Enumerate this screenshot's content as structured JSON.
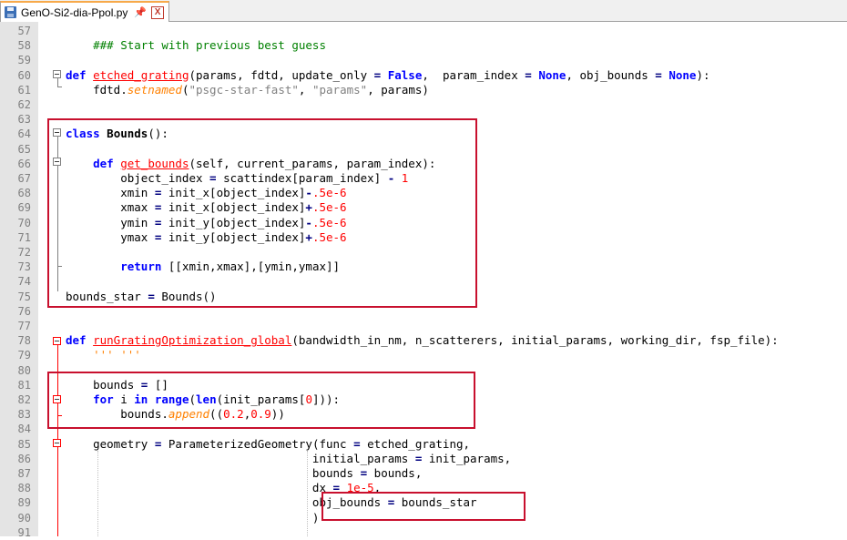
{
  "tab": {
    "filename": "GenO-Si2-dia-Ppol.py",
    "close_glyph": "X",
    "pin_glyph": "📌"
  },
  "editor": {
    "first_line": 57,
    "lines": [
      {
        "n": "57",
        "tokens": []
      },
      {
        "n": "58",
        "tokens": [
          {
            "t": "    ",
            "c": ""
          },
          {
            "t": "### Start with previous best guess",
            "c": "cm"
          }
        ]
      },
      {
        "n": "59",
        "tokens": []
      },
      {
        "n": "60",
        "tokens": [
          {
            "t": "def",
            "c": "kw"
          },
          {
            "t": " ",
            "c": ""
          },
          {
            "t": "etched_grating",
            "c": "fn"
          },
          {
            "t": "(params, fdtd, update_only ",
            "c": ""
          },
          {
            "t": "=",
            "c": "op"
          },
          {
            "t": " ",
            "c": ""
          },
          {
            "t": "False",
            "c": "kw"
          },
          {
            "t": ",  param_index ",
            "c": ""
          },
          {
            "t": "=",
            "c": "op"
          },
          {
            "t": " ",
            "c": ""
          },
          {
            "t": "None",
            "c": "kw"
          },
          {
            "t": ", obj_bounds ",
            "c": ""
          },
          {
            "t": "=",
            "c": "op"
          },
          {
            "t": " ",
            "c": ""
          },
          {
            "t": "None",
            "c": "kw"
          },
          {
            "t": "):",
            "c": ""
          }
        ]
      },
      {
        "n": "61",
        "tokens": [
          {
            "t": "    fdtd.",
            "c": ""
          },
          {
            "t": "setnamed",
            "c": "meth"
          },
          {
            "t": "(",
            "c": ""
          },
          {
            "t": "\"psgc-star-fast\"",
            "c": "str"
          },
          {
            "t": ", ",
            "c": ""
          },
          {
            "t": "\"params\"",
            "c": "str"
          },
          {
            "t": ", params)",
            "c": ""
          }
        ]
      },
      {
        "n": "62",
        "tokens": []
      },
      {
        "n": "63",
        "tokens": []
      },
      {
        "n": "64",
        "tokens": [
          {
            "t": "class",
            "c": "kw"
          },
          {
            "t": " ",
            "c": ""
          },
          {
            "t": "Bounds",
            "c": "cls"
          },
          {
            "t": "():",
            "c": ""
          }
        ]
      },
      {
        "n": "65",
        "tokens": []
      },
      {
        "n": "66",
        "tokens": [
          {
            "t": "    ",
            "c": ""
          },
          {
            "t": "def",
            "c": "kw"
          },
          {
            "t": " ",
            "c": ""
          },
          {
            "t": "get_bounds",
            "c": "fn"
          },
          {
            "t": "(self, current_params, param_index):",
            "c": ""
          }
        ]
      },
      {
        "n": "67",
        "tokens": [
          {
            "t": "        object_index ",
            "c": ""
          },
          {
            "t": "=",
            "c": "op"
          },
          {
            "t": " scattindex[param_index] ",
            "c": ""
          },
          {
            "t": "-",
            "c": "op"
          },
          {
            "t": " ",
            "c": ""
          },
          {
            "t": "1",
            "c": "num"
          }
        ]
      },
      {
        "n": "68",
        "tokens": [
          {
            "t": "        xmin ",
            "c": ""
          },
          {
            "t": "=",
            "c": "op"
          },
          {
            "t": " init_x[object_index]",
            "c": ""
          },
          {
            "t": "-",
            "c": "op"
          },
          {
            "t": ".5e-6",
            "c": "num"
          }
        ]
      },
      {
        "n": "69",
        "tokens": [
          {
            "t": "        xmax ",
            "c": ""
          },
          {
            "t": "=",
            "c": "op"
          },
          {
            "t": " init_x[object_index]",
            "c": ""
          },
          {
            "t": "+",
            "c": "op"
          },
          {
            "t": ".5e-6",
            "c": "num"
          }
        ]
      },
      {
        "n": "70",
        "tokens": [
          {
            "t": "        ymin ",
            "c": ""
          },
          {
            "t": "=",
            "c": "op"
          },
          {
            "t": " init_y[object_index]",
            "c": ""
          },
          {
            "t": "-",
            "c": "op"
          },
          {
            "t": ".5e-6",
            "c": "num"
          }
        ]
      },
      {
        "n": "71",
        "tokens": [
          {
            "t": "        ymax ",
            "c": ""
          },
          {
            "t": "=",
            "c": "op"
          },
          {
            "t": " init_y[object_index]",
            "c": ""
          },
          {
            "t": "+",
            "c": "op"
          },
          {
            "t": ".5e-6",
            "c": "num"
          }
        ]
      },
      {
        "n": "72",
        "tokens": []
      },
      {
        "n": "73",
        "tokens": [
          {
            "t": "        ",
            "c": ""
          },
          {
            "t": "return",
            "c": "kw"
          },
          {
            "t": " [[xmin,xmax],[ymin,ymax]]",
            "c": ""
          }
        ]
      },
      {
        "n": "74",
        "tokens": []
      },
      {
        "n": "75",
        "tokens": [
          {
            "t": "bounds_star ",
            "c": ""
          },
          {
            "t": "=",
            "c": "op"
          },
          {
            "t": " Bounds()",
            "c": ""
          }
        ]
      },
      {
        "n": "76",
        "tokens": []
      },
      {
        "n": "77",
        "tokens": []
      },
      {
        "n": "78",
        "tokens": [
          {
            "t": "def",
            "c": "kw"
          },
          {
            "t": " ",
            "c": ""
          },
          {
            "t": "runGratingOptimization_global",
            "c": "fn"
          },
          {
            "t": "(bandwidth_in_nm, n_scatterers, initial_params, working_dir, fsp_file):",
            "c": ""
          }
        ]
      },
      {
        "n": "79",
        "tokens": [
          {
            "t": "    ",
            "c": ""
          },
          {
            "t": "''' '''",
            "c": "meth"
          }
        ]
      },
      {
        "n": "80",
        "tokens": []
      },
      {
        "n": "81",
        "tokens": [
          {
            "t": "    bounds ",
            "c": ""
          },
          {
            "t": "=",
            "c": "op"
          },
          {
            "t": " []",
            "c": ""
          }
        ]
      },
      {
        "n": "82",
        "tokens": [
          {
            "t": "    ",
            "c": ""
          },
          {
            "t": "for",
            "c": "kw"
          },
          {
            "t": " i ",
            "c": ""
          },
          {
            "t": "in",
            "c": "kw"
          },
          {
            "t": " ",
            "c": ""
          },
          {
            "t": "range",
            "c": "kw"
          },
          {
            "t": "(",
            "c": ""
          },
          {
            "t": "len",
            "c": "kw"
          },
          {
            "t": "(init_params[",
            "c": ""
          },
          {
            "t": "0",
            "c": "num"
          },
          {
            "t": "])):",
            "c": ""
          }
        ]
      },
      {
        "n": "83",
        "tokens": [
          {
            "t": "        bounds.",
            "c": ""
          },
          {
            "t": "append",
            "c": "meth"
          },
          {
            "t": "((",
            "c": ""
          },
          {
            "t": "0.2",
            "c": "num"
          },
          {
            "t": ",",
            "c": ""
          },
          {
            "t": "0.9",
            "c": "num"
          },
          {
            "t": "))",
            "c": ""
          }
        ]
      },
      {
        "n": "84",
        "tokens": []
      },
      {
        "n": "85",
        "tokens": [
          {
            "t": "    geometry ",
            "c": ""
          },
          {
            "t": "=",
            "c": "op"
          },
          {
            "t": " ParameterizedGeometry(func ",
            "c": ""
          },
          {
            "t": "=",
            "c": "op"
          },
          {
            "t": " etched_grating,",
            "c": ""
          }
        ]
      },
      {
        "n": "86",
        "tokens": [
          {
            "t": "                                    initial_params ",
            "c": ""
          },
          {
            "t": "=",
            "c": "op"
          },
          {
            "t": " init_params,",
            "c": ""
          }
        ]
      },
      {
        "n": "87",
        "tokens": [
          {
            "t": "                                    bounds ",
            "c": ""
          },
          {
            "t": "=",
            "c": "op"
          },
          {
            "t": " bounds,",
            "c": ""
          }
        ]
      },
      {
        "n": "88",
        "tokens": [
          {
            "t": "                                    dx ",
            "c": ""
          },
          {
            "t": "=",
            "c": "op"
          },
          {
            "t": " ",
            "c": ""
          },
          {
            "t": "1e-5",
            "c": "num"
          },
          {
            "t": ",",
            "c": ""
          }
        ]
      },
      {
        "n": "89",
        "tokens": [
          {
            "t": "                                    obj_bounds ",
            "c": ""
          },
          {
            "t": "=",
            "c": "op"
          },
          {
            "t": " bounds_star",
            "c": ""
          }
        ]
      },
      {
        "n": "90",
        "tokens": [
          {
            "t": "                                    )",
            "c": ""
          }
        ]
      },
      {
        "n": "91",
        "tokens": []
      }
    ]
  },
  "colors": {
    "highlight_box": "#c8102e",
    "keyword": "#0000ff",
    "function_name": "#ff0000",
    "comment": "#008000",
    "number": "#ff0000",
    "string": "#808080"
  }
}
